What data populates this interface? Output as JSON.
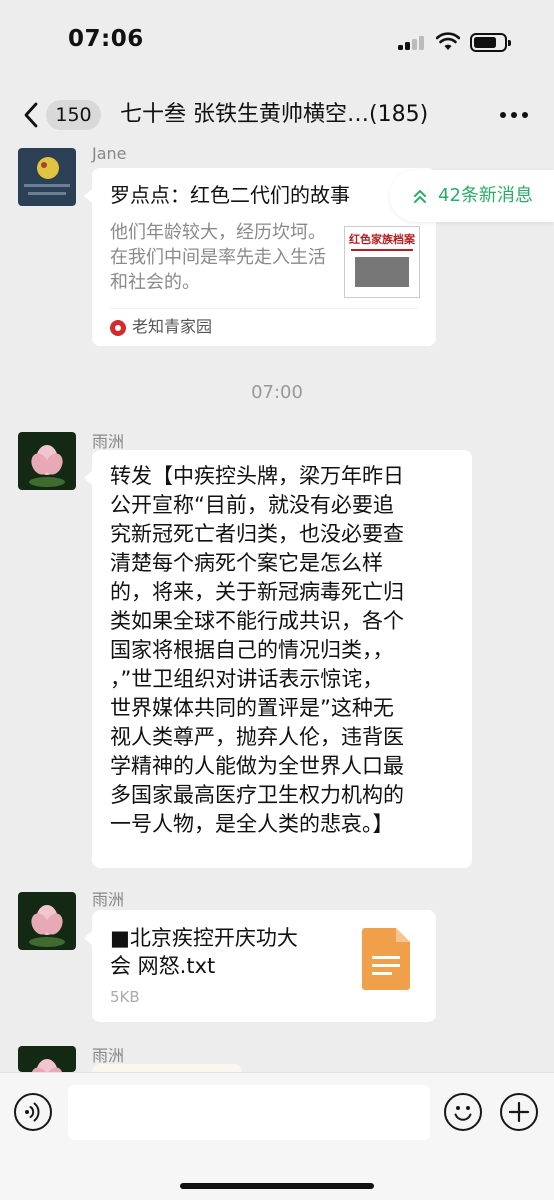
{
  "status_bar": {
    "time": "07:06"
  },
  "nav": {
    "unread_count": "150",
    "title": "七十叁 张铁生黄帅横空…(185)"
  },
  "new_messages_pill": "42条新消息",
  "messages": [
    {
      "sender": "Jane",
      "type": "link",
      "title": "罗点点：红色二代们的故事",
      "description": "他们年龄较大，经历坎坷。在我们中间是率先走入生活和社会的。",
      "thumbnail_text": "红色家族档案",
      "source": "老知青家园"
    },
    {
      "type": "time",
      "text": "07:00"
    },
    {
      "sender": "雨洲",
      "type": "text",
      "lines": [
        "转发【中疾控头牌，梁万年昨日",
        "公开宣称“目前，就没有必要追",
        "究新冠死亡者归类，也没必要查",
        "清楚每个病死个案它是怎么样",
        "的，将来，关于新冠病毒死亡归",
        "类如果全球不能行成共识，各个",
        "国家将根据自己的情况归类，，",
        "，”世卫组织对讲话表示惊诧，",
        "世界媒体共同的置评是”这种无",
        "视人类尊严，抛弃人伦，违背医",
        "学精神的人能做为全世界人口最",
        "多国家最高医疗卫生权力机构的",
        "一号人物，是全人类的悲哀。】"
      ]
    },
    {
      "sender": "雨洲",
      "type": "file",
      "file_name_lines": [
        "■北京疾控开庆功大",
        "会 网怒.txt"
      ],
      "file_size": "5KB"
    },
    {
      "sender": "雨洲",
      "type": "partial"
    }
  ],
  "input": {
    "placeholder": ""
  }
}
